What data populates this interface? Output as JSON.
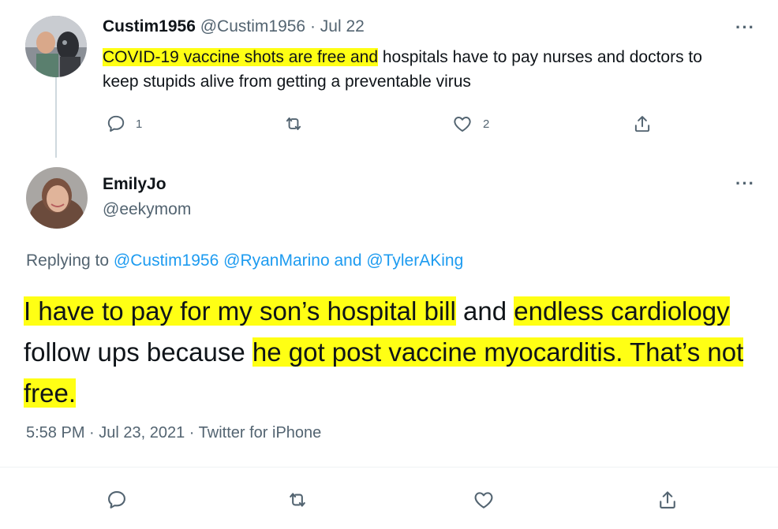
{
  "tweet1": {
    "display_name": "Custim1956",
    "handle": "@Custim1956",
    "separator": "·",
    "date": "Jul 22",
    "body_highlighted": "COVID-19 vaccine shots are free and",
    "body_rest": " hospitals have to pay nurses and doctors to keep stupids alive from getting a preventable virus",
    "reply_count": "1",
    "like_count": "2",
    "more_label": "···"
  },
  "tweet2": {
    "display_name": "EmilyJo",
    "handle": "@eekymom",
    "replying_prefix": "Replying to",
    "mention1": "@Custim1956",
    "mention2": "@RyanMarino",
    "replying_and": "and",
    "mention3": "@TylerAKing",
    "body": {
      "seg1_hl": "I have to pay for my son’s hospital bill",
      "seg2": " and ",
      "seg3_hl": "endless cardiology",
      "seg4": " follow ups because ",
      "seg5_hl": "he got post vaccine myocarditis. That’s not free."
    },
    "time": "5:58 PM · Jul 23, 2021",
    "meta_separator": "·",
    "source": "Twitter for iPhone",
    "more_label": "···"
  },
  "icons": [
    "reply-icon",
    "retweet-icon",
    "like-icon",
    "share-icon"
  ],
  "colors": {
    "highlight": "#ffff14",
    "link": "#1d9bf0",
    "secondary_text": "#536471",
    "primary_text": "#0f1419"
  }
}
